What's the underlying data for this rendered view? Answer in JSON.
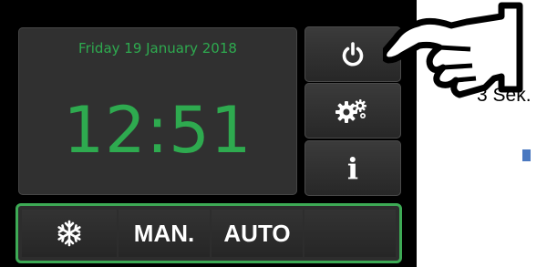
{
  "display": {
    "date": "Friday 19 January 2018",
    "time": "12:51"
  },
  "side_buttons": {
    "power_icon": "power-icon",
    "settings_icon": "gears-icon",
    "info_label": "i"
  },
  "mode_bar": {
    "snow_icon": "snowflake-icon",
    "manual_label": "MAN.",
    "auto_label": "AUTO"
  },
  "annotation": {
    "hold_text": "3 Sek.",
    "hand_icon": "pointing-hand-icon"
  },
  "colors": {
    "accent_green": "#2eaa4f",
    "panel_bg": "#000000",
    "button_bg": "#303030"
  }
}
